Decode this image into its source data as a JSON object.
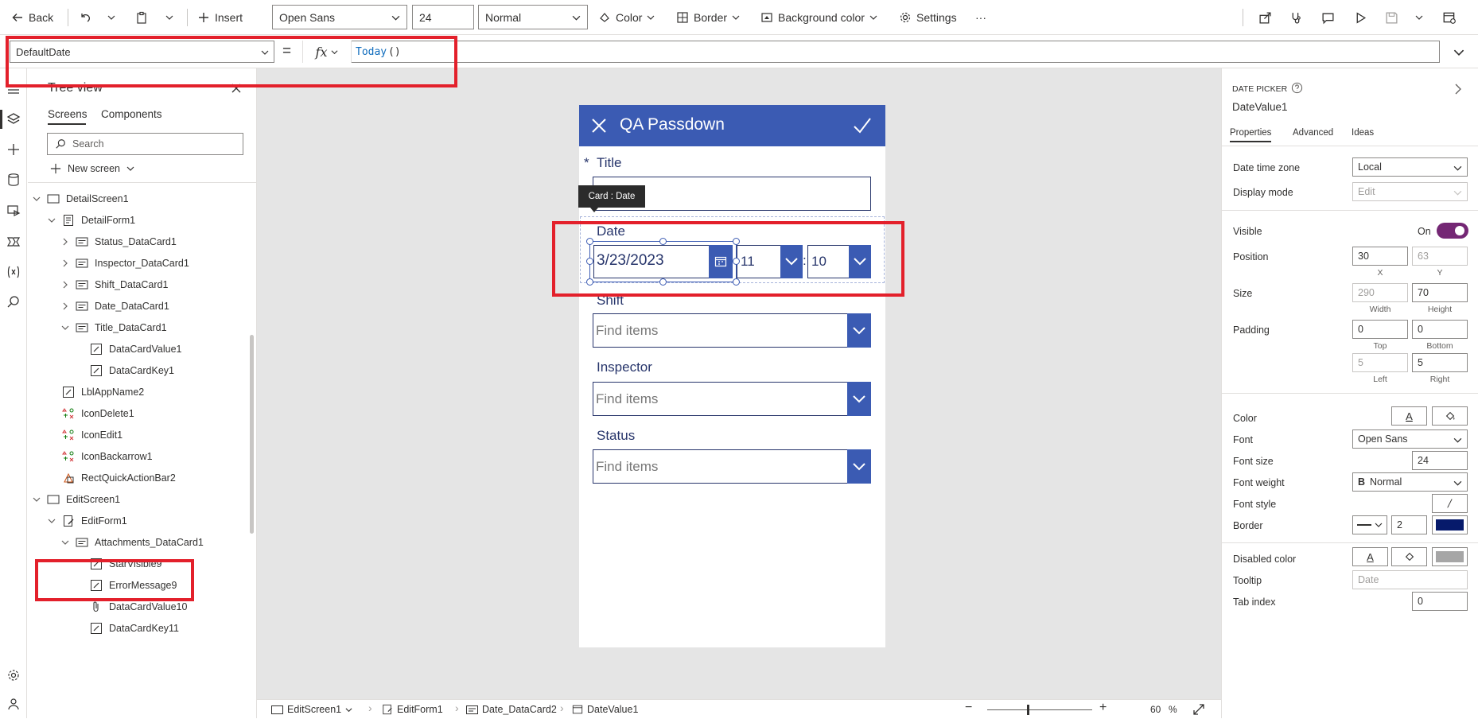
{
  "toolbar": {
    "back_label": "Back",
    "insert_label": "Insert",
    "font_value": "Open Sans",
    "font_size_value": "24",
    "font_weight_value": "Normal",
    "color_label": "Color",
    "border_label": "Border",
    "background_color_label": "Background color",
    "settings_label": "Settings",
    "more_label": "···"
  },
  "formula_bar": {
    "property": "DefaultDate",
    "equals": "=",
    "fx": "fx",
    "formula_fn": "Today",
    "formula_parens": "()"
  },
  "tree": {
    "title": "Tree view",
    "tabs": [
      "Screens",
      "Components"
    ],
    "search_placeholder": "Search",
    "new_screen_label": "New screen",
    "items": [
      {
        "label": "DetailScreen1",
        "icon": "screen-icon"
      },
      {
        "label": "DetailForm1",
        "icon": "form-icon"
      },
      {
        "label": "Status_DataCard1",
        "icon": "card-icon"
      },
      {
        "label": "Inspector_DataCard1",
        "icon": "card-icon"
      },
      {
        "label": "Shift_DataCard1",
        "icon": "card-icon"
      },
      {
        "label": "Date_DataCard1",
        "icon": "card-icon"
      },
      {
        "label": "Title_DataCard1",
        "icon": "card-icon"
      },
      {
        "label": "DataCardValue1",
        "icon": "label-icon"
      },
      {
        "label": "DataCardKey1",
        "icon": "label-icon"
      },
      {
        "label": "LblAppName2",
        "icon": "label-icon"
      },
      {
        "label": "IconDelete1",
        "icon": "icons-icon"
      },
      {
        "label": "IconEdit1",
        "icon": "icons-icon"
      },
      {
        "label": "IconBackarrow1",
        "icon": "icons-icon"
      },
      {
        "label": "RectQuickActionBar2",
        "icon": "shape-icon"
      },
      {
        "label": "EditScreen1",
        "icon": "screen-icon"
      },
      {
        "label": "EditForm1",
        "icon": "edit-form-icon"
      },
      {
        "label": "Attachments_DataCard1",
        "icon": "card-icon"
      },
      {
        "label": "StarVisible9",
        "icon": "label-icon"
      },
      {
        "label": "ErrorMessage9",
        "icon": "label-icon"
      },
      {
        "label": "DataCardValue10",
        "icon": "attachment-icon"
      },
      {
        "label": "DataCardKey11",
        "icon": "label-icon"
      }
    ]
  },
  "app": {
    "header_title": "QA Passdown",
    "title_label": "Title",
    "title_required_star": "*",
    "tooltip": "Card : Date",
    "date_label": "Date",
    "date_value": "3/23/2023",
    "hour_value": "11",
    "time_sep": ":",
    "minute_value": "10",
    "shift_label": "Shift",
    "inspector_label": "Inspector",
    "status_label": "Status",
    "find_placeholder": "Find items"
  },
  "props": {
    "type_label": "DATE PICKER",
    "control_name": "DateValue1",
    "tabs": [
      "Properties",
      "Advanced",
      "Ideas"
    ],
    "date_time_zone_label": "Date time zone",
    "date_time_zone_value": "Local",
    "display_mode_label": "Display mode",
    "display_mode_value": "Edit",
    "visible_label": "Visible",
    "visible_value": "On",
    "position_label": "Position",
    "position_x": "30",
    "position_y": "63",
    "x_label": "X",
    "y_label": "Y",
    "size_label": "Size",
    "size_width": "290",
    "size_height": "70",
    "width_label": "Width",
    "height_label": "Height",
    "padding_label": "Padding",
    "padding_top": "0",
    "padding_bottom": "0",
    "padding_left": "5",
    "padding_right": "5",
    "top_label": "Top",
    "bottom_label": "Bottom",
    "left_label": "Left",
    "right_label": "Right",
    "color_label": "Color",
    "font_label": "Font",
    "font_value": "Open Sans",
    "font_size_label": "Font size",
    "font_size_value": "24",
    "font_weight_label": "Font weight",
    "font_weight_value": "Normal",
    "font_style_label": "Font style",
    "border_label": "Border",
    "border_width_value": "2",
    "disabled_color_label": "Disabled color",
    "tooltip_label": "Tooltip",
    "tooltip_placeholder": "Date",
    "tab_index_label": "Tab index",
    "tab_index_value": "0",
    "border_color": "#061a6b"
  },
  "bottom_bar": {
    "crumbs": [
      "EditScreen1",
      "EditForm1",
      "Date_DataCard2",
      "DateValue1"
    ],
    "zoom_value": "60",
    "zoom_unit": "%"
  },
  "colors": {
    "app_accent": "#3b5bb3",
    "toggle_on": "#742774",
    "annotation_red": "#e3202b"
  }
}
